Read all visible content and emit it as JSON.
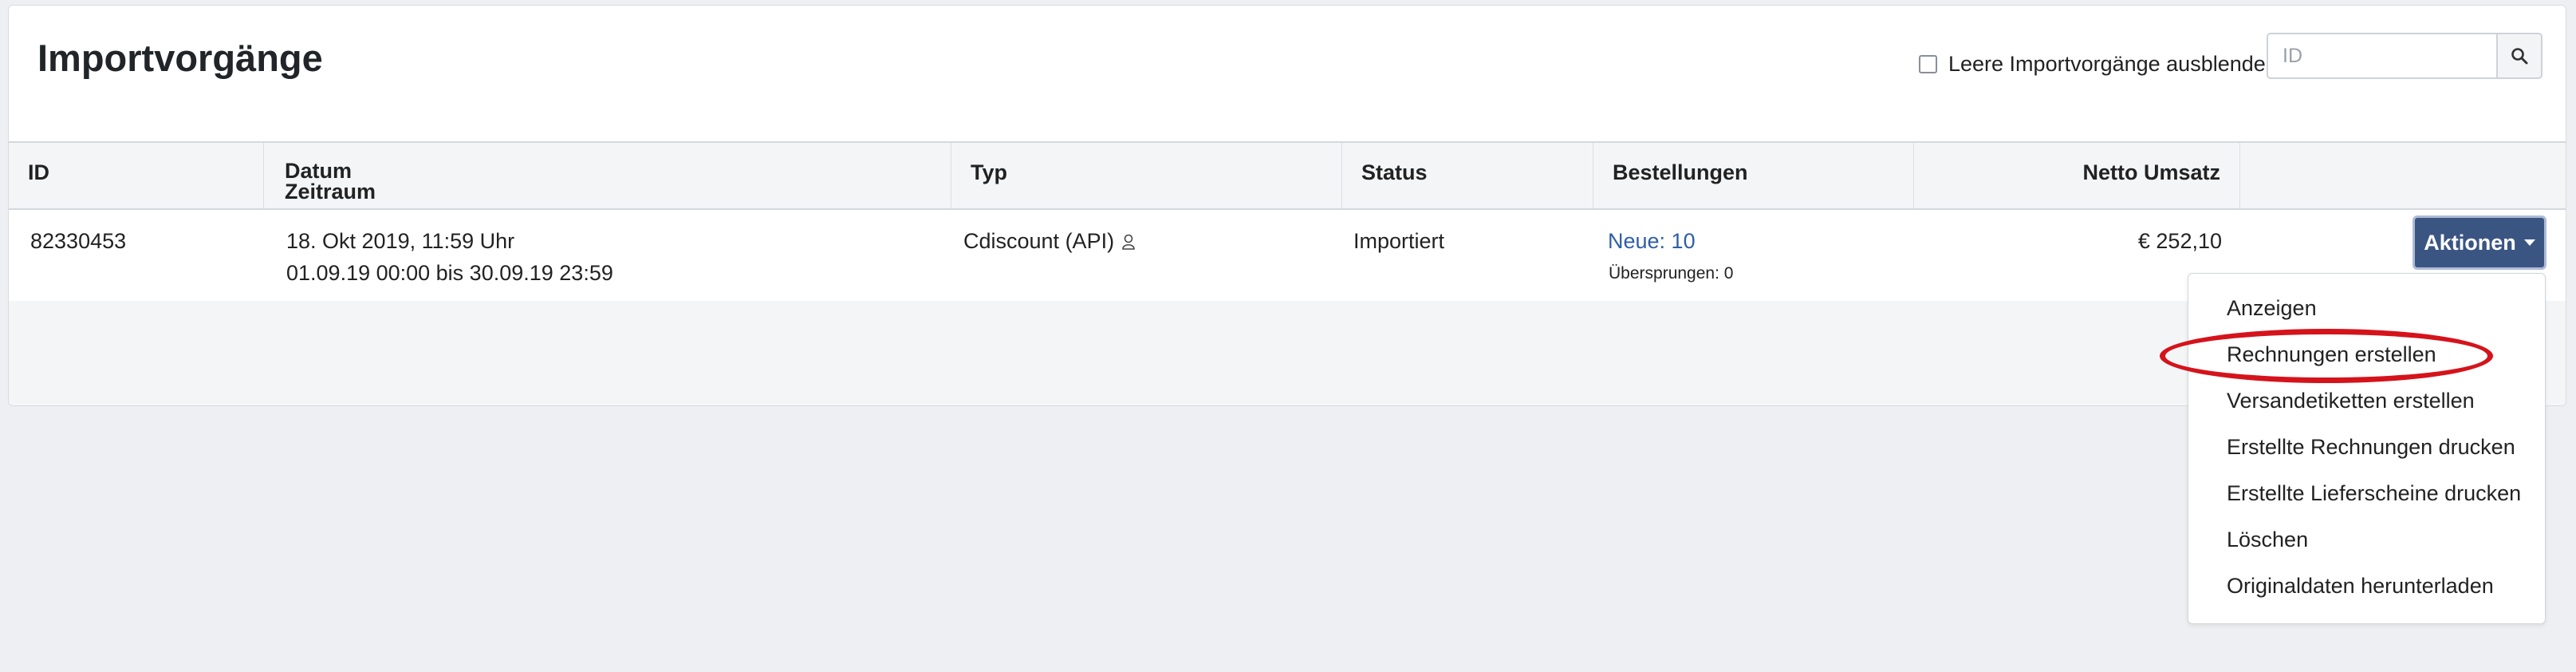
{
  "page_title": "Importvorgänge",
  "filter": {
    "hide_empty_label": "Leere Importvorgänge ausblenden",
    "hide_empty_checked": false
  },
  "search": {
    "placeholder": "ID",
    "value": "",
    "icon": "search-icon"
  },
  "table": {
    "headers": {
      "id": "ID",
      "datum": "Datum",
      "zeitraum": "Zeitraum",
      "typ": "Typ",
      "status": "Status",
      "bestellungen": "Bestellungen",
      "netto_umsatz": "Netto Umsatz"
    },
    "rows": [
      {
        "id": "82330453",
        "datum": "18. Okt 2019, 11:59 Uhr",
        "zeitraum": "01.09.19 00:00 bis 30.09.19 23:59",
        "typ": "Cdiscount (API)",
        "typ_icon": "user-icon",
        "status": "Importiert",
        "bestellungen_neue": "Neue: 10",
        "bestellungen_uebersprungen": "Übersprungen: 0",
        "netto_umsatz": "€ 252,10"
      }
    ]
  },
  "actions": {
    "button_label": "Aktionen",
    "menu_items": [
      "Anzeigen",
      "Rechnungen erstellen",
      "Versandetiketten erstellen",
      "Erstellte Rechnungen drucken",
      "Erstellte Lieferscheine drucken",
      "Löschen",
      "Originaldaten herunterladen"
    ],
    "highlighted_item": "Rechnungen erstellen"
  },
  "colors": {
    "accent_button": "#3b5583",
    "link": "#2f5ea8",
    "highlight_annotation": "#d5131b"
  }
}
